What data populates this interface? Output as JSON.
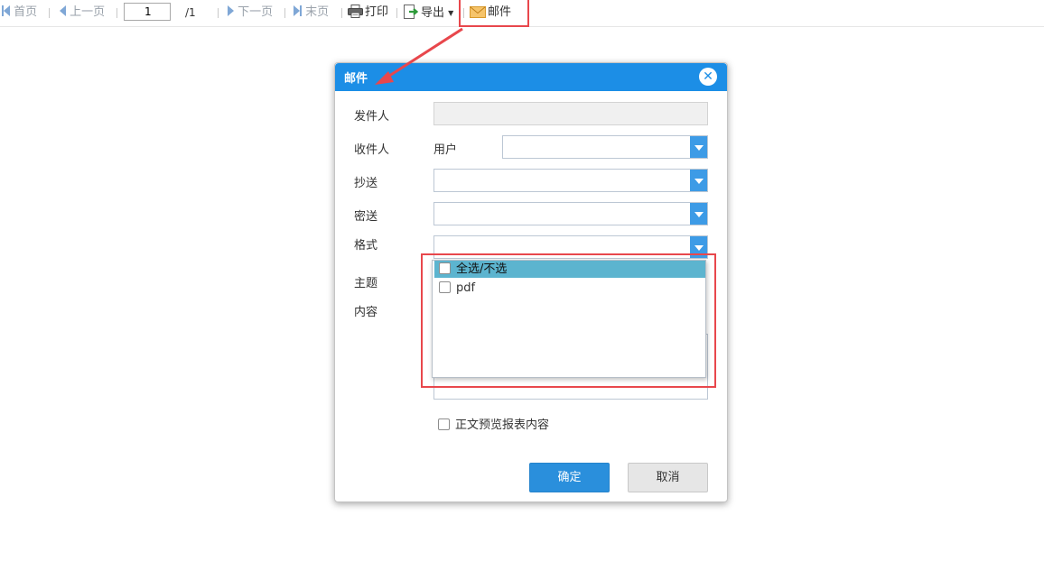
{
  "toolbar": {
    "first_page": "首页",
    "prev_page": "上一页",
    "page_value": "1",
    "page_total": "/1",
    "next_page": "下一页",
    "last_page": "末页",
    "print": "打印",
    "export": "导出",
    "mail": "邮件"
  },
  "dialog": {
    "title": "邮件",
    "sender_label": "发件人",
    "sender_value": "",
    "recipient_label": "收件人",
    "recipient_type": "用户",
    "cc_label": "抄送",
    "bcc_label": "密送",
    "format_label": "格式",
    "subject_label": "主题",
    "content_label": "内容",
    "preview_label": "正文预览报表内容",
    "ok_button": "确定",
    "cancel_button": "取消"
  },
  "format_dropdown": {
    "options": [
      "全选/不选",
      "pdf"
    ],
    "highlighted_index": 0
  },
  "colors": {
    "header_blue": "#1c8ee6",
    "ok_blue": "#2a8fdc",
    "annotation_red": "#e8474c",
    "dropdown_highlight": "#5cb4cf"
  }
}
